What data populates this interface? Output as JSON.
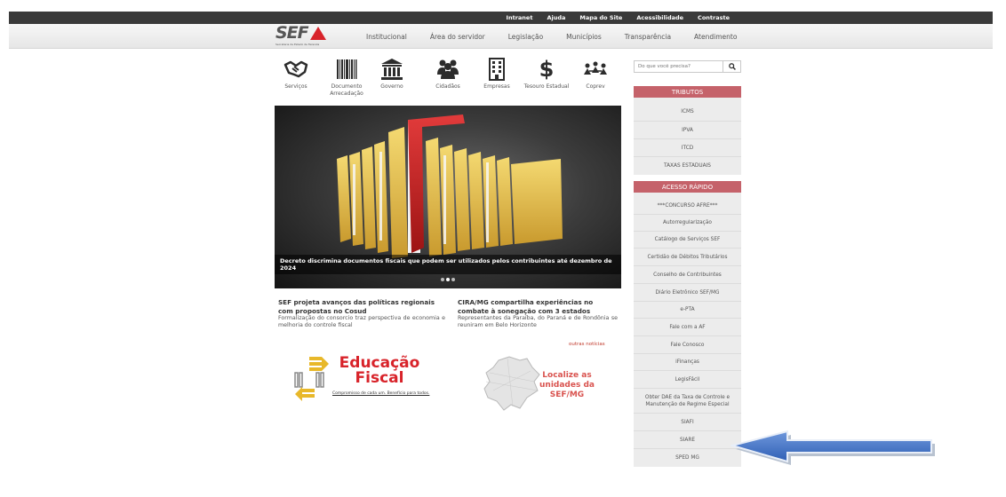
{
  "top_links": [
    "Intranet",
    "Ajuda",
    "Mapa do Site",
    "Acessibilidade",
    "Contraste"
  ],
  "logo": {
    "text": "SEF",
    "subtitle": "Secretaria de Estado de Fazenda"
  },
  "main_nav": [
    "Institucional",
    "Área do servidor",
    "Legislação",
    "Municípios",
    "Transparência",
    "Atendimento"
  ],
  "services": [
    {
      "label": "Serviços",
      "icon": "handshake-icon"
    },
    {
      "label": "Documento Arrecadação",
      "icon": "barcode-icon"
    },
    {
      "label": "Governo",
      "icon": "government-building-icon"
    },
    {
      "label": "Cidadãos",
      "icon": "people-icon"
    },
    {
      "label": "Empresas",
      "icon": "building-icon"
    },
    {
      "label": "Tesouro Estadual",
      "icon": "dollar-icon"
    },
    {
      "label": "Coprev",
      "icon": "group-network-icon"
    }
  ],
  "slider": {
    "caption": "Decreto discrimina documentos fiscais que podem ser utilizados pelos contribuintes até dezembro de 2024",
    "image": "yellow-file-folders-illustration"
  },
  "news": [
    {
      "title": "SEF projeta avanços das políticas regionais com propostas no Cosud",
      "summary": "Formalização do consorcio traz perspectiva de economia e melhoria do controle fiscal"
    },
    {
      "title": "CIRA/MG compartilha experiências no combate à sonegação com 3 estados",
      "summary": "Representantes da Paraíba, do Paraná e de Rondônia se reuniram em Belo Horizonte"
    }
  ],
  "more_news": "outras notícias",
  "search": {
    "placeholder": "Do que você precisa?"
  },
  "tributos": {
    "header": "TRIBUTOS",
    "items": [
      "ICMS",
      "IPVA",
      "ITCD",
      "TAXAS ESTADUAIS"
    ]
  },
  "acesso_rapido": {
    "header": "ACESSO RÁPIDO",
    "items": [
      "***CONCURSO AFRE***",
      "Autorregularização",
      "Catálogo de Serviços SEF",
      "Certidão de Débitos Tributários",
      "Conselho de Contribuintes",
      "Diário Eletrônico SEF/MG",
      "e-PTA",
      "Fale com a AF",
      "Fale Conosco",
      "iFinanças",
      "LegisFácil",
      "Obter DAE da Taxa de Controle e Manutenção de Regime Especial",
      "SIAFI",
      "SIARE",
      "SPED MG"
    ]
  },
  "promo_edu": {
    "line1": "Educação",
    "line2": "Fiscal",
    "tagline": "Compromisso de cada um. Benefício para todos."
  },
  "promo_map": {
    "text": "Localize as unidades da SEF/MG"
  },
  "colors": {
    "topbar": "#3a3a3a",
    "panel_header": "#c5626a",
    "brand_red": "#d8232a",
    "arrow": "#3a6fc4"
  }
}
